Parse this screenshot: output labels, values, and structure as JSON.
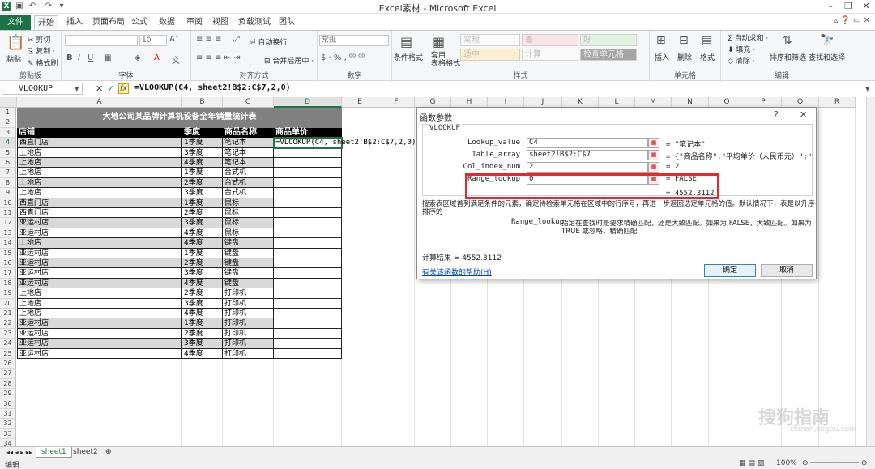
{
  "window": {
    "title": "Excel素材 - Microsoft Excel"
  },
  "ribbon_tabs": [
    "文件",
    "开始",
    "插入",
    "页面布局",
    "公式",
    "数据",
    "审阅",
    "视图",
    "负载测试",
    "团队"
  ],
  "ribbon": {
    "paste": "粘贴",
    "cut": "剪切",
    "copy": "复制 ·",
    "format_painter": "格式刷",
    "clipboard_label": "剪贴板",
    "font_size": "10",
    "font_label": "字体",
    "wrap_text": "自动换行",
    "merge_center": "合并后居中 ·",
    "alignment_label": "对齐方式",
    "number_format": "常规",
    "number_label": "数字",
    "conditional_format": "条件格式",
    "table_format": "套用\n表格格式",
    "styles": [
      "常规",
      "差",
      "好",
      "适中",
      "计算",
      "检查单元格"
    ],
    "styles_label": "样式",
    "insert": "插入",
    "delete": "删除",
    "format": "格式",
    "cells_label": "单元格",
    "autosum": "Σ 自动求和 ·",
    "fill": "填充 ·",
    "clear": "清除 ·",
    "sort_filter": "排序和筛选",
    "find_select": "查找和选择",
    "editing_label": "编辑"
  },
  "formula_bar": {
    "name_box": "VLOOKUP",
    "formula": "=VLOOKUP(C4, sheet2!B$2:C$7,2,0)"
  },
  "columns": [
    "A",
    "B",
    "C",
    "D",
    "E",
    "F",
    "G",
    "H",
    "I",
    "J",
    "K",
    "L",
    "M",
    "N",
    "O",
    "P",
    "Q",
    "R"
  ],
  "rows": [
    "1",
    "2",
    "3",
    "4",
    "5",
    "6",
    "7",
    "8",
    "9",
    "10",
    "11",
    "12",
    "13",
    "14",
    "15",
    "16",
    "17",
    "18",
    "19",
    "20",
    "21",
    "22",
    "23",
    "24",
    "25",
    "26",
    "27",
    "28",
    "29",
    "30",
    "31",
    "32",
    "33",
    "34"
  ],
  "sheet": {
    "title": "大地公司某品牌计算机设备全年销量统计表",
    "headers": [
      "店铺",
      "季度",
      "商品名称",
      "商品单价"
    ],
    "active_cell_formula": "=VLOOKUP(C4, sheet2!B$2:C$7,2,0)",
    "data": [
      [
        "西直门店",
        "1季度",
        "笔记本"
      ],
      [
        "上地店",
        "3季度",
        "笔记本"
      ],
      [
        "上地店",
        "4季度",
        "笔记本"
      ],
      [
        "上地店",
        "1季度",
        "台式机"
      ],
      [
        "上地店",
        "2季度",
        "台式机"
      ],
      [
        "上地店",
        "3季度",
        "台式机"
      ],
      [
        "西直门店",
        "1季度",
        "鼠标"
      ],
      [
        "西直门店",
        "2季度",
        "鼠标"
      ],
      [
        "亚运村店",
        "3季度",
        "鼠标"
      ],
      [
        "亚运村店",
        "4季度",
        "鼠标"
      ],
      [
        "上地店",
        "4季度",
        "键盘"
      ],
      [
        "亚运村店",
        "1季度",
        "键盘"
      ],
      [
        "亚运村店",
        "2季度",
        "键盘"
      ],
      [
        "亚运村店",
        "3季度",
        "键盘"
      ],
      [
        "亚运村店",
        "4季度",
        "键盘"
      ],
      [
        "上地店",
        "2季度",
        "打印机"
      ],
      [
        "上地店",
        "3季度",
        "打印机"
      ],
      [
        "上地店",
        "4季度",
        "打印机"
      ],
      [
        "亚运村店",
        "1季度",
        "打印机"
      ],
      [
        "亚运村店",
        "2季度",
        "打印机"
      ],
      [
        "亚运村店",
        "3季度",
        "打印机"
      ],
      [
        "亚运村店",
        "4季度",
        "打印机"
      ]
    ],
    "gray_rows": [
      0,
      2,
      4,
      6,
      8,
      10,
      12,
      14,
      18,
      20
    ]
  },
  "sheet_tabs": [
    "sheet1",
    "sheet2"
  ],
  "status": {
    "mode": "编辑",
    "zoom": "100%"
  },
  "dialog": {
    "title": "函数参数",
    "help_btn": "?",
    "close_btn": "✕",
    "function_name": "VLOOKUP",
    "args": [
      {
        "name": "Lookup_value",
        "value": "C4",
        "result": "= \"笔记本\""
      },
      {
        "name": "Table_array",
        "value": "sheet2!B$2:C$7",
        "result": "= {\"商品名称\",\"平均单价（人民币元）\";\"笔记"
      },
      {
        "name": "Col_index_num",
        "value": "2",
        "result": "= 2"
      },
      {
        "name": "Range_lookup",
        "value": "0",
        "result": "= FALSE"
      }
    ],
    "final_result": "= 4552.3112",
    "description": "搜索表区域首列满足条件的元素，确定待检索单元格在区域中的行序号，再进一步返回选定单元格的值。默认情况下，表是以升序",
    "description2": "排序的",
    "arg_help_name": "Range_lookup",
    "arg_help_text": "指定在查找时是要求精确匹配，还是大致匹配。如果为 FALSE，大致匹配。如果为",
    "arg_help_text2": "TRUE 或忽略，精确匹配",
    "calc_result": "计算结果 =  4552.3112",
    "help_link": "有关该函数的帮助(H)",
    "ok": "确定",
    "cancel": "取消"
  },
  "watermark": {
    "text": "搜狗指南",
    "sub": "zhinan.sogou.com"
  }
}
